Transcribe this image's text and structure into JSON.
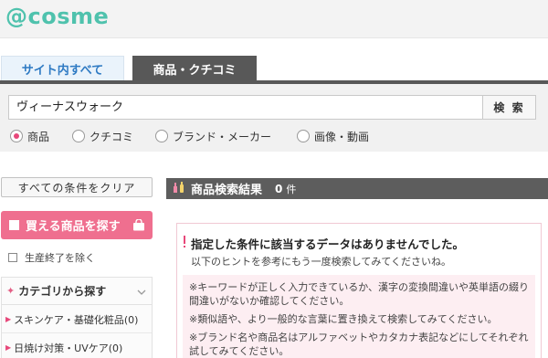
{
  "header": {
    "logo": "@cosme"
  },
  "tabs": [
    {
      "label": "サイト内すべて",
      "active": false
    },
    {
      "label": "商品・クチコミ",
      "active": true
    }
  ],
  "search": {
    "value": "ヴィーナスウォーク",
    "button_label": "検 索",
    "options": [
      {
        "label": "商品",
        "selected": true
      },
      {
        "label": "クチコミ",
        "selected": false
      },
      {
        "label": "ブランド・メーカー",
        "selected": false
      },
      {
        "label": "画像・動画",
        "selected": false
      }
    ]
  },
  "sidebar": {
    "clear_label": "すべての条件をクリア",
    "buyable_label": "買える商品を探す",
    "exclude_label": "生産終了を除く",
    "category_title": "カテゴリから探す",
    "categories": [
      {
        "label": "スキンケア・基礎化粧品(0)"
      },
      {
        "label": "日焼け対策・UVケア(0)"
      }
    ]
  },
  "results": {
    "title": "商品検索結果",
    "count": "0",
    "unit": "件"
  },
  "message": {
    "heading": "指定した条件に該当するデータはありませんでした。",
    "sub": "以下のヒントを参考にもう一度検索してみてくださいね。",
    "hints": [
      "※キーワードが正しく入力できているか、漢字の変換間違いや英単語の綴り間違いがないか確認してください。",
      "※類似語や、より一般的な言葉に置き換えて検索してみてください。",
      "※ブランド名や商品名はアルファベットやカタカナ表記などにしてそれぞれ試してみてください。"
    ]
  },
  "colors": {
    "brand": "#4fc2ad",
    "accent_pink": "#e7487a",
    "dark_bar": "#585858",
    "tab_blue": "#2e7ac3"
  }
}
